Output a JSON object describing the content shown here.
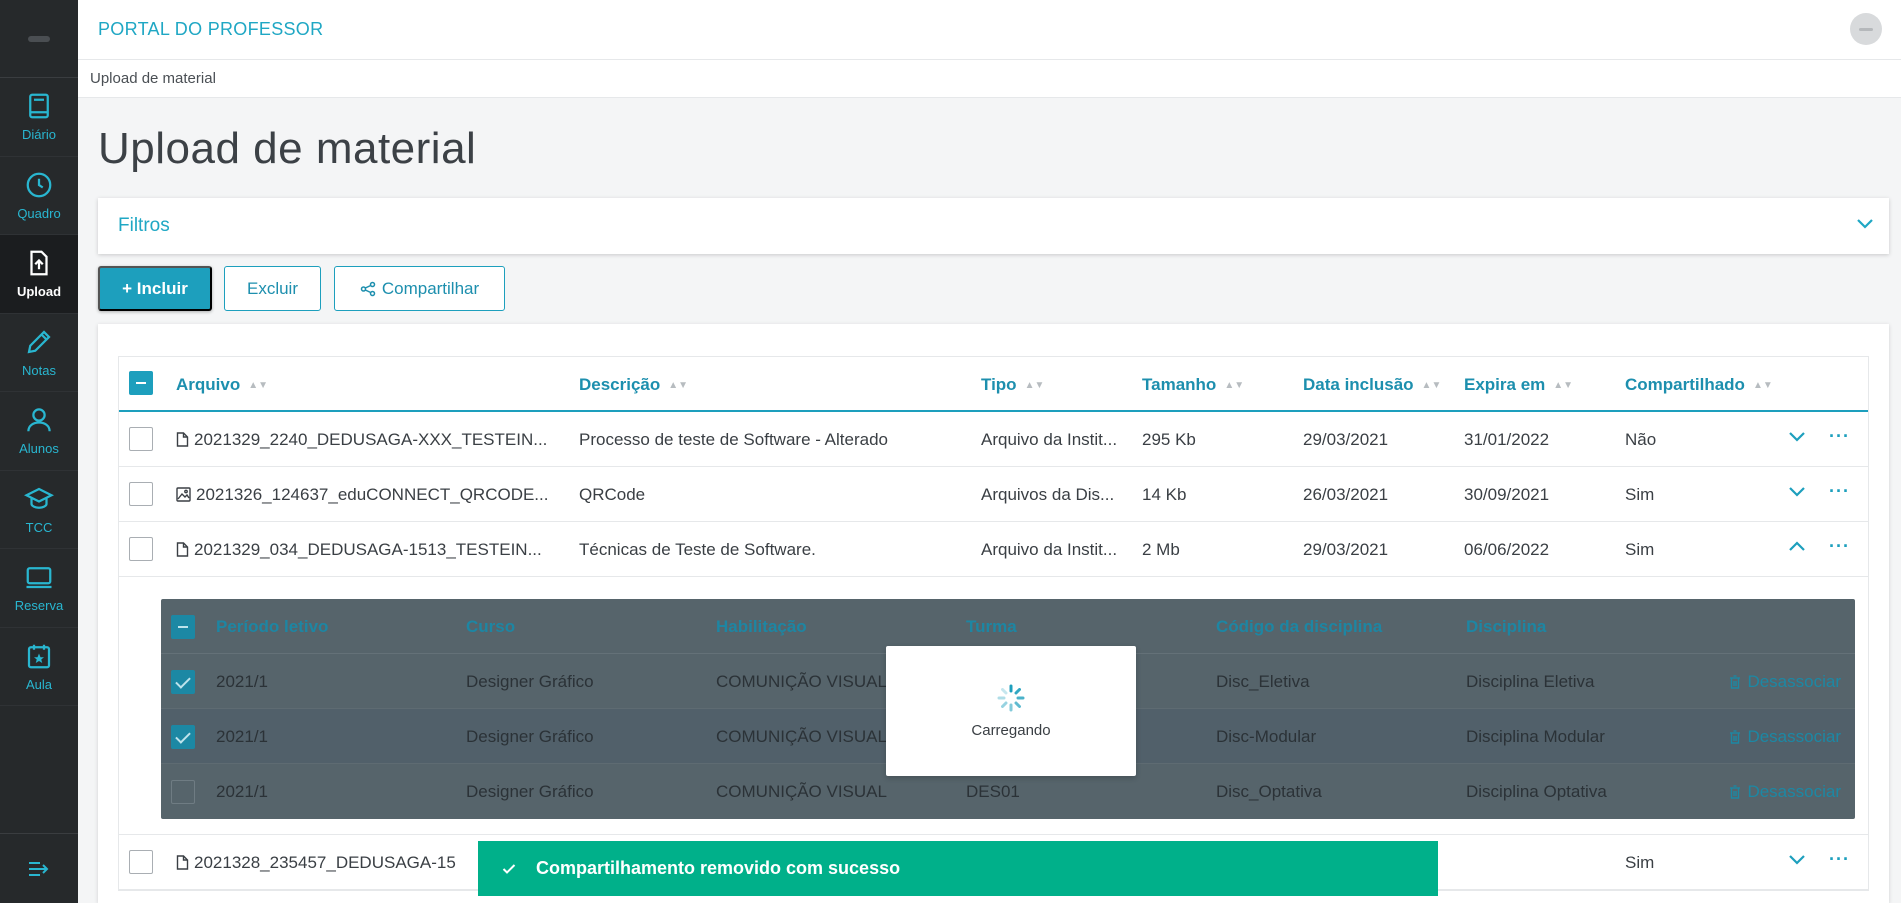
{
  "app": {
    "title": "PORTAL DO PROFESSOR"
  },
  "sidebar": {
    "items": [
      {
        "label": "Diário",
        "icon": "book-icon"
      },
      {
        "label": "Quadro",
        "icon": "clock-icon"
      },
      {
        "label": "Upload",
        "icon": "upload-file-icon",
        "active": true
      },
      {
        "label": "Notas",
        "icon": "pencil-icon"
      },
      {
        "label": "Alunos",
        "icon": "user-icon"
      },
      {
        "label": "TCC",
        "icon": "graduation-cap-icon"
      },
      {
        "label": "Reserva",
        "icon": "monitor-icon"
      },
      {
        "label": "Aula",
        "icon": "calendar-star-icon"
      }
    ]
  },
  "breadcrumb": {
    "current": "Upload de material"
  },
  "page": {
    "title": "Upload de material"
  },
  "filters": {
    "title": "Filtros"
  },
  "actions": {
    "include": "+ Incluir",
    "delete": "Excluir",
    "share": "Compartilhar"
  },
  "table": {
    "headers": [
      "Arquivo",
      "Descrição",
      "Tipo",
      "Tamanho",
      "Data inclusão",
      "Expira em",
      "Compartilhado"
    ],
    "rows": [
      {
        "file": "2021329_2240_DEDUSAGA-XXX_TESTEIN...",
        "icon": "file-icon",
        "description": "Processo de teste de Software - Alterado",
        "type": "Arquivo da Instit...",
        "size": "295 Kb",
        "included": "29/03/2021",
        "expires": "31/01/2022",
        "shared": "Não"
      },
      {
        "file": "2021326_124637_eduCONNECT_QRCODE...",
        "icon": "image-icon",
        "description": "QRCode",
        "type": "Arquivos da Dis...",
        "size": "14 Kb",
        "included": "26/03/2021",
        "expires": "30/09/2021",
        "shared": "Sim"
      },
      {
        "file": "2021329_034_DEDUSAGA-1513_TESTEIN...",
        "icon": "file-icon",
        "description": "Técnicas de Teste de Software.",
        "type": "Arquivo da Instit...",
        "size": "2 Mb",
        "included": "29/03/2021",
        "expires": "06/06/2022",
        "shared": "Sim"
      },
      {
        "file": "2021328_235457_DEDUSAGA-15",
        "icon": "file-icon",
        "description": "",
        "type": "",
        "size": "",
        "included": "",
        "expires": "",
        "shared": "Sim"
      }
    ]
  },
  "subtable": {
    "headers": [
      "Período letivo",
      "Curso",
      "Habilitação",
      "Turma",
      "Código da disciplina",
      "Disciplina"
    ],
    "action_label": "Desassociar",
    "rows": [
      {
        "periodo": "2021/1",
        "curso": "Designer Gráfico",
        "habilitacao": "COMUNIÇÃO VISUAL",
        "turma": "",
        "codigo": "Disc_Eletiva",
        "disciplina": "Disciplina Eletiva",
        "checked": true
      },
      {
        "periodo": "2021/1",
        "curso": "Designer Gráfico",
        "habilitacao": "COMUNIÇÃO VISUAL",
        "turma": "",
        "codigo": "Disc-Modular",
        "disciplina": "Disciplina Modular",
        "checked": true
      },
      {
        "periodo": "2021/1",
        "curso": "Designer Gráfico",
        "habilitacao": "COMUNIÇÃO VISUAL",
        "turma": "DES01",
        "codigo": "Disc_Optativa",
        "disciplina": "Disciplina Optativa",
        "checked": false
      }
    ]
  },
  "loading": {
    "text": "Carregando"
  },
  "toast": {
    "message": "Compartilhamento removido com sucesso"
  },
  "colors": {
    "accent": "#1d9fbd",
    "sidebar": "#26292b",
    "toast": "#00b08a",
    "overlay": "#56646b"
  }
}
